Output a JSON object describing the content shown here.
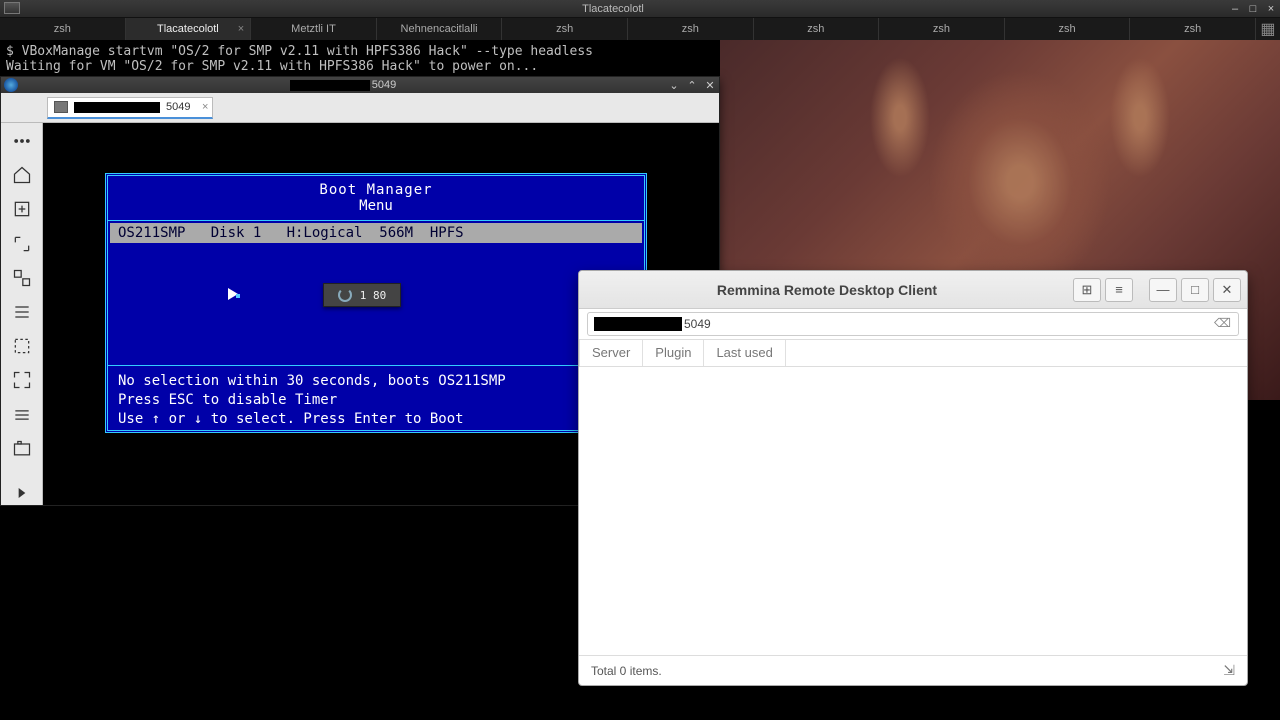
{
  "window": {
    "title": "Tlacatecolotl",
    "minimize": "–",
    "maximize": "□",
    "close": "×"
  },
  "tabs": [
    {
      "label": "zsh",
      "active": false
    },
    {
      "label": "Tlacatecolotl",
      "active": true,
      "closable": true
    },
    {
      "label": "Metztli IT",
      "active": false
    },
    {
      "label": "Nehnencacitlalli",
      "active": false
    },
    {
      "label": "zsh",
      "active": false
    },
    {
      "label": "zsh",
      "active": false
    },
    {
      "label": "zsh",
      "active": false
    },
    {
      "label": "zsh",
      "active": false
    },
    {
      "label": "zsh",
      "active": false
    },
    {
      "label": "zsh",
      "active": false
    }
  ],
  "terminal": {
    "line1": "$ VBoxManage startvm \"OS/2 for SMP v2.11 with HPFS386 Hack\" --type headless",
    "line2": "Waiting for VM \"OS/2 for SMP v2.11 with HPFS386 Hack\" to power on..."
  },
  "viewer": {
    "title_suffix": "5049",
    "tab_suffix": "5049",
    "titlebar": {
      "dropdown": "⌄",
      "up": "⌃",
      "close": "✕"
    }
  },
  "sidebar_icons": [
    "menu",
    "home",
    "new-tab",
    "fullscreen-toggle",
    "scaled",
    "list",
    "dyn-res",
    "fullscreen",
    "bars",
    "screenshot",
    "expand"
  ],
  "bootmgr": {
    "title": "Boot Manager",
    "subtitle": "Menu",
    "row": "OS211SMP   Disk 1   H:Logical  566M  HPFS",
    "loader_text": "1 80",
    "foot1": "No selection within 30 seconds, boots OS211SMP",
    "foot2": "Press ESC to disable Timer",
    "foot3": "Use ↑ or ↓ to select. Press Enter to Boot"
  },
  "remmina": {
    "title": "Remmina Remote Desktop Client",
    "addr_suffix": "5049",
    "columns": [
      "Server",
      "Plugin",
      "Last used"
    ],
    "status": "Total 0 items.",
    "buttons": {
      "grid": "⊞",
      "list": "≡",
      "minimize": "—",
      "maximize": "□",
      "close": "✕"
    }
  }
}
